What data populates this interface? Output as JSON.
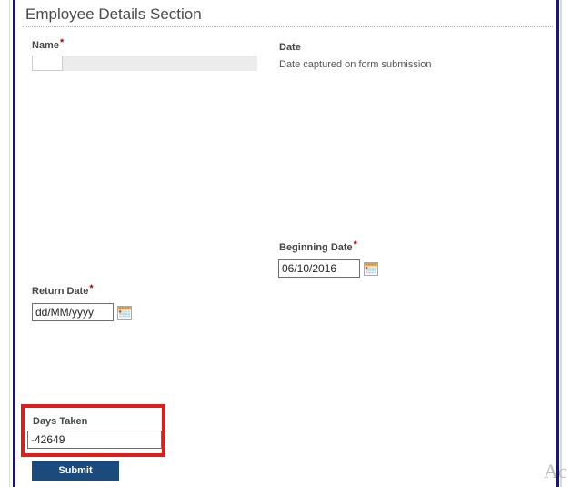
{
  "header": {
    "title": "Employee Details Section"
  },
  "form": {
    "name": {
      "label": "Name",
      "required": true,
      "value": ""
    },
    "date": {
      "label": "Date",
      "help_text": "Date captured on form submission"
    },
    "beginning_date": {
      "label": "Beginning Date",
      "required": true,
      "value": "06/10/2016"
    },
    "return_date": {
      "label": "Return Date",
      "required": true,
      "value": "dd/MM/yyyy"
    },
    "days_taken": {
      "label": "Days Taken",
      "value": "-42649"
    }
  },
  "buttons": {
    "submit_label": "Submit"
  },
  "misc": {
    "required_marker": "*",
    "watermark": "Ac"
  },
  "colors": {
    "page_border_navy": "#181866",
    "submit_blue": "#1b4a7c",
    "annotation_red": "#e11c1c",
    "required_red": "#c00000",
    "name_field_gray": "#ececec",
    "title_gray": "#4a4a4a"
  }
}
